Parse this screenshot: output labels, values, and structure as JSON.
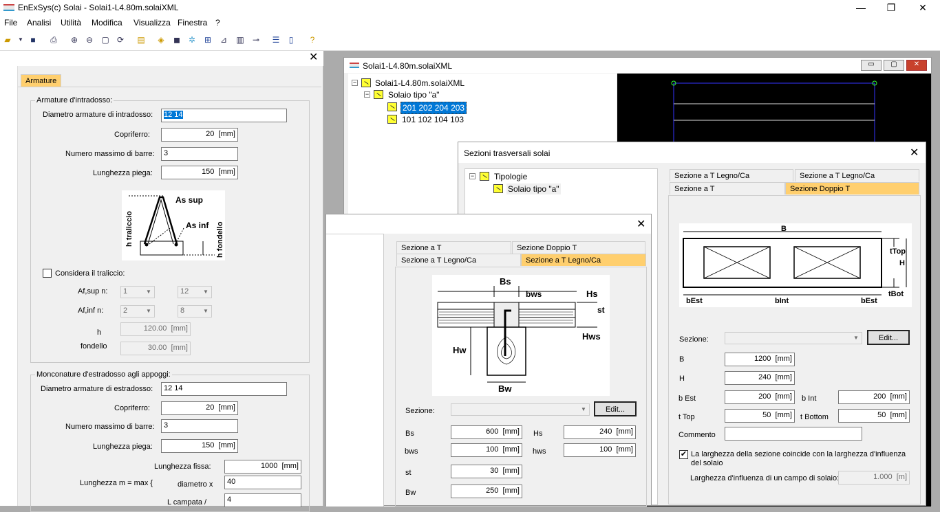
{
  "app": {
    "title": "EnExSys(c) Solai - Solai1-L4.80m.solaiXML",
    "minimize": "—",
    "restore": "❐",
    "close": "✕"
  },
  "menu": [
    "File",
    "Analisi",
    "Utilità",
    "Modifica",
    "Visualizza",
    "Finestra",
    "?"
  ],
  "left": {
    "tab": "Armature",
    "intradosso": {
      "group": "Armature d'intradosso:",
      "diametro_label": "Diametro armature di intradosso:",
      "diametro_value": "12 14",
      "copriferro_label": "Copriferro:",
      "copriferro_value": "20",
      "copriferro_unit": "[mm]",
      "nbarre_label": "Numero massimo di barre:",
      "nbarre_value": "3",
      "piega_label": "Lunghezza piega:",
      "piega_value": "150",
      "piega_unit": "[mm]",
      "fig": {
        "as_sup": "As sup",
        "as_inf": "As inf",
        "h_tralic": "h traliccio",
        "h_fond": "h fondello"
      },
      "traliccio_label": "Considera il traliccio:",
      "afsup_label": "Af,sup n:",
      "afsup_n": "1",
      "afsup_d": "12",
      "afinf_label": "Af,inf n:",
      "afinf_n": "2",
      "afinf_d": "8",
      "h_label": "h",
      "h_value": "120.00",
      "h_unit": "[mm]",
      "fondello_label": "fondello",
      "fondello_value": "30.00",
      "fondello_unit": "[mm]"
    },
    "estradosso": {
      "group": "Monconature d'estradosso agli appoggi:",
      "diametro_label": "Diametro armature di estradosso:",
      "diametro_value": "12 14",
      "copriferro_label": "Copriferro:",
      "copriferro_value": "20",
      "copriferro_unit": "[mm]",
      "nbarre_label": "Numero massimo di barre:",
      "nbarre_value": "3",
      "piega_label": "Lunghezza piega:",
      "piega_value": "150",
      "piega_unit": "[mm]",
      "lfissa_label": "Lunghezza fissa:",
      "lfissa_value": "1000",
      "lfissa_unit": "[mm]",
      "lm_label": "Lunghezza m = max {",
      "diam_label": "diametro x",
      "diam_value": "40",
      "lcamp_label": "L campata /",
      "lcamp_value": "4"
    }
  },
  "docwin": {
    "title": "Solai1-L4.80m.solaiXML",
    "tree": [
      "Solai1-L4.80m.solaiXML",
      "Solaio tipo \"a\"",
      "201 202 204 203",
      "101 102 104 103"
    ]
  },
  "sez1": {
    "title": "Sezioni trasversali solai",
    "tree": [
      "Tipologie",
      "Solaio tipo \"a\""
    ],
    "tabs": [
      "Sezione a T Legno/Ca",
      "Sezione a T Legno/Ca",
      "Sezione a T",
      "Sezione Doppio T"
    ],
    "fig": {
      "B": "B",
      "tTop": "tTop",
      "H": "H",
      "tBot": "tBot",
      "bEst1": "bEst",
      "bInt": "bInt",
      "bEst2": "bEst"
    },
    "sezione_label": "Sezione:",
    "edit": "Edit...",
    "B_label": "B",
    "B_value": "1200",
    "unit": "[mm]",
    "H_label": "H",
    "H_value": "240",
    "bEst_label": "b Est",
    "bEst_value": "200",
    "bInt_label": "b Int",
    "bInt_value": "200",
    "tTop_label": "t Top",
    "tTop_value": "50",
    "tBot_label": "t Bottom",
    "tBot_value": "50",
    "commento_label": "Commento",
    "chk_label": "La larghezza della sezione coincide con la larghezza d'influenza del solaio",
    "infl_label": "Larghezza d'influenza di un campo di solaio:",
    "infl_value": "1.000",
    "infl_unit": "[m]"
  },
  "sez2": {
    "tabs": [
      "Sezione a T",
      "Sezione Doppio T",
      "Sezione a T Legno/Ca",
      "Sezione a T Legno/Ca"
    ],
    "fig": {
      "Bs": "Bs",
      "bws": "bws",
      "Hs": "Hs",
      "st": "st",
      "Hws": "Hws",
      "Hw": "Hw",
      "Bw": "Bw"
    },
    "sezione_label": "Sezione:",
    "edit": "Edit...",
    "unit": "[mm]",
    "Bs_label": "Bs",
    "Bs_value": "600",
    "Hs_label": "Hs",
    "Hs_value": "240",
    "bws_label": "bws",
    "bws_value": "100",
    "hws_label": "hws",
    "hws_value": "100",
    "st_label": "st",
    "st_value": "30",
    "Bw_label": "Bw",
    "Bw_value": "250"
  }
}
